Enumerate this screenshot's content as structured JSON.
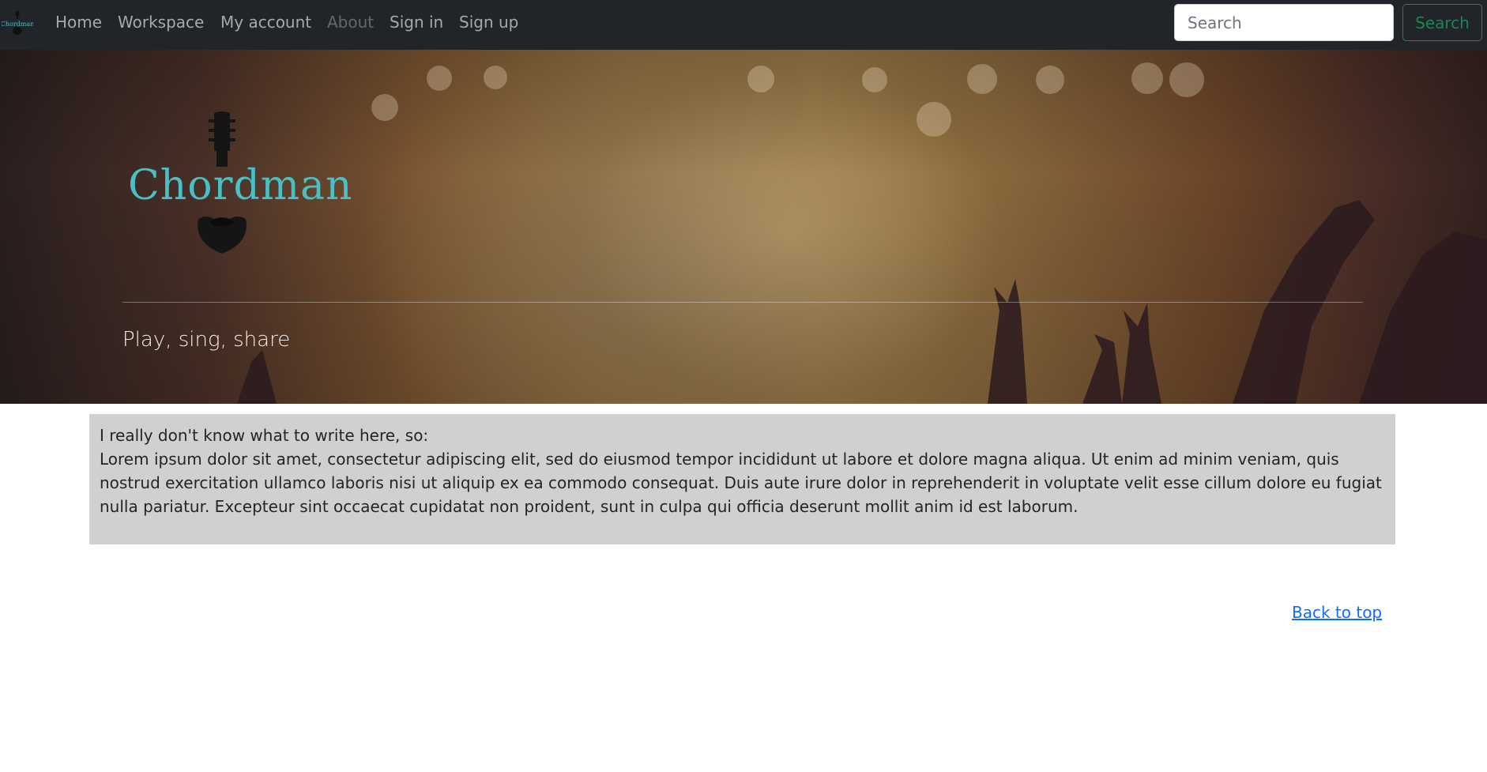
{
  "nav": {
    "brand_alt": "Chordman",
    "links": [
      {
        "label": "Home",
        "disabled": false
      },
      {
        "label": "Workspace",
        "disabled": false
      },
      {
        "label": "My account",
        "disabled": false
      },
      {
        "label": "About",
        "disabled": true
      },
      {
        "label": "Sign in",
        "disabled": false
      },
      {
        "label": "Sign up",
        "disabled": false
      }
    ],
    "search_placeholder": "Search",
    "search_button": "Search"
  },
  "hero": {
    "logo_text": "Chordman",
    "tagline": "Play, sing, share"
  },
  "content": {
    "intro": "I really don't know what to write here, so:",
    "body": "Lorem ipsum dolor sit amet, consectetur adipiscing elit, sed do eiusmod tempor incididunt ut labore et dolore magna aliqua. Ut enim ad minim veniam, quis nostrud exercitation ullamco laboris nisi ut aliquip ex ea commodo consequat. Duis aute irure dolor in reprehenderit in voluptate velit esse cillum dolore eu fugiat nulla pariatur. Excepteur sint occaecat cupidatat non proident, sunt in culpa qui officia deserunt mollit anim id est laborum."
  },
  "footer": {
    "back_to_top": "Back to top"
  },
  "colors": {
    "navbar_bg": "#212529",
    "brand_teal": "#48c0c6",
    "search_button": "#198754",
    "link_blue": "#0d6efd",
    "content_bg": "#d0d0d0"
  }
}
